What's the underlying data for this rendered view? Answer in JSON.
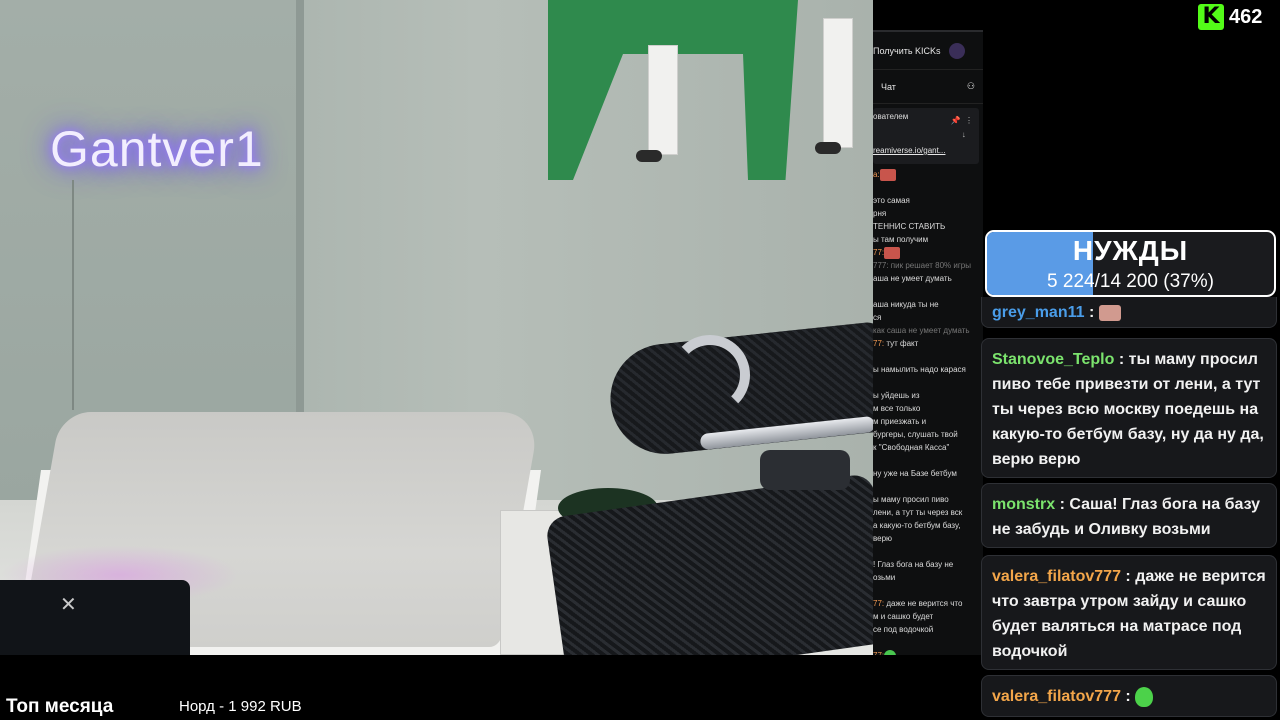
{
  "stream": {
    "neon_sign": "Gantver1",
    "viewer_count": "462",
    "platform_logo": "kick-logo",
    "brand_color": "#53fc18"
  },
  "embedded_chat": {
    "top_button": "Получить KICKs",
    "chat_header": "Чат",
    "pinned_author": "ователем",
    "pinned_link": "reamiverse.io/gant...",
    "pinned_icons": [
      "pin-icon",
      "more-icon",
      "collapse-icon"
    ],
    "messages": [
      {
        "name": "а:",
        "text": "",
        "emote": "red"
      },
      {
        "text": ""
      },
      {
        "text": "это самая"
      },
      {
        "text": "рня"
      },
      {
        "text": "ТЕННИС СТАВИТЬ"
      },
      {
        "text": "ы там получим"
      },
      {
        "name": "77:",
        "text": "",
        "emote": "red"
      },
      {
        "text": "777: пик решает 80% игры",
        "dim": true
      },
      {
        "text": "аша не умеет думать"
      },
      {
        "text": ""
      },
      {
        "text": "аша никуда ты не"
      },
      {
        "text": "ся"
      },
      {
        "text": "как саша не умеет думать",
        "dim": true
      },
      {
        "name": "77:",
        "text": " тут факт"
      },
      {
        "text": ""
      },
      {
        "text": "ы намылить надо карася"
      },
      {
        "text": ""
      },
      {
        "text": "ы уйдешь из"
      },
      {
        "text": "м все только"
      },
      {
        "text": "м приезжать и"
      },
      {
        "text": "бургеры, слушать твой"
      },
      {
        "text": "к \"Свободная Касса\""
      },
      {
        "text": ""
      },
      {
        "text": "ну уже на Базе бетбум"
      },
      {
        "text": ""
      },
      {
        "text": "ы маму просил пиво"
      },
      {
        "text": "лени, а тут ты через вск"
      },
      {
        "text": "а какую-то бетбум базу,"
      },
      {
        "text": "верю"
      },
      {
        "text": ""
      },
      {
        "text": "! Глаз бога на базу не"
      },
      {
        "text": "озьми"
      },
      {
        "text": ""
      },
      {
        "name": "77:",
        "text": " даже не верится что"
      },
      {
        "text": "м и сашко будет"
      },
      {
        "text": "се под водочкой"
      },
      {
        "text": ""
      },
      {
        "name": "77:",
        "text": "",
        "emote": "green"
      }
    ]
  },
  "goal": {
    "title": "НУЖДЫ",
    "progress_text": "5 224/14 200 (37%)",
    "progress_fraction": 0.37,
    "fill_color": "#5a9be6"
  },
  "side_chat": [
    {
      "user": "grey_man11",
      "sep": " : ",
      "text": "",
      "emote": "red",
      "color": "blue"
    },
    {
      "user": "Stanovoe_Teplo",
      "sep": " : ",
      "text": "ты маму просил пиво тебе привезти от лени, а тут ты через всю москву поедешь на какую-то бетбум базу, ну да ну да, верю верю",
      "color": "green"
    },
    {
      "user": "monstrx",
      "sep": " : ",
      "text": "Саша! Глаз бога на базу не забудь и Оливку возьми",
      "color": "green"
    },
    {
      "user": "valera_filatov777",
      "sep": " : ",
      "text": "даже не верится что завтра утром зайду и сашко будет валяться на матрасе под водочкой",
      "color": "orange"
    },
    {
      "user": "valera_filatov777",
      "sep": " : ",
      "text": "",
      "emote": "green",
      "color": "orange"
    }
  ],
  "bottom": {
    "title": "Топ месяца",
    "donor": "Норд - 1 992 RUB"
  }
}
